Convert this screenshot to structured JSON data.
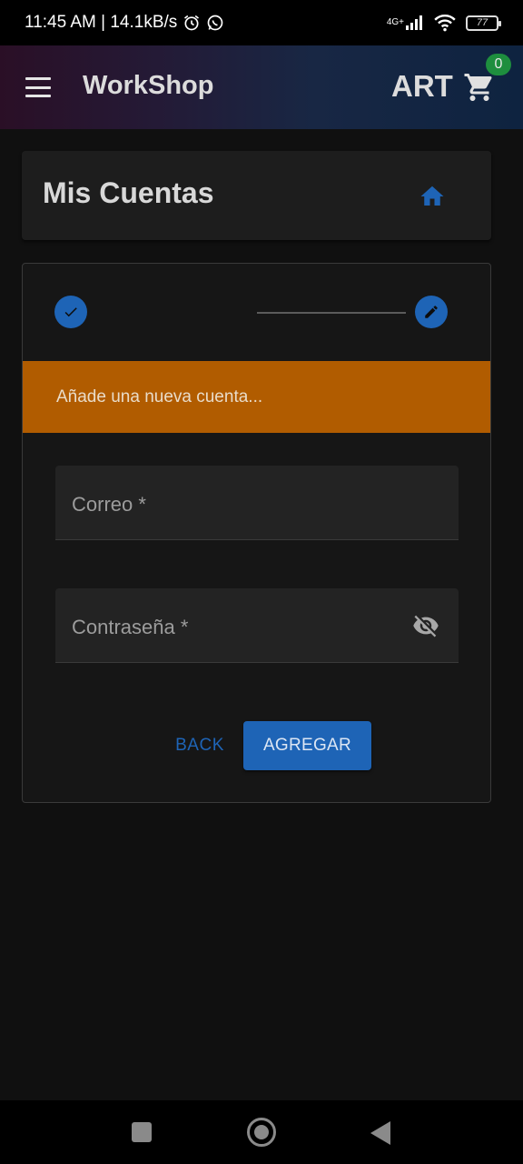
{
  "status_bar": {
    "time_speed": "11:45 AM | 14.1kB/s",
    "network_type": "4G+",
    "battery_level": "77",
    "icons": [
      "alarm-icon",
      "whatsapp-icon",
      "signal-icon",
      "wifi-icon",
      "battery-icon"
    ]
  },
  "app_bar": {
    "title": "WorkShop",
    "brand": "ART",
    "cart_count": "0",
    "gradient_colors": [
      "#2a0f26",
      "#182744",
      "#0e2340"
    ]
  },
  "page": {
    "title": "Mis Cuentas"
  },
  "stepper": {
    "banner_text": "Añade una nueva cuenta...",
    "step_color": "#1e64b6",
    "banner_color": "#b15c00"
  },
  "form": {
    "email_label": "Correo *",
    "password_label": "Contraseña *",
    "back_label": "BACK",
    "submit_label": "AGREGAR"
  },
  "colors": {
    "accent": "#1e64b6",
    "badge": "#1e8e3e",
    "background": "#101010"
  }
}
